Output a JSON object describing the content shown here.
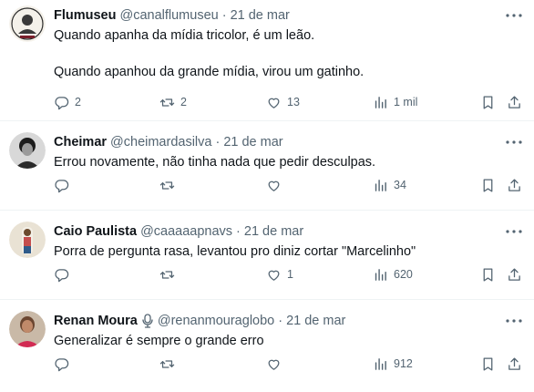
{
  "tweets": [
    {
      "name": "Flumuseu",
      "handle": "@canalflumuseu",
      "date": "21 de mar",
      "text": "Quando apanha da mídia tricolor, é um leão.\n\nQuando apanhou da grande mídia, virou um gatinho.",
      "replies": "2",
      "retweets": "2",
      "likes": "13",
      "views": "1 mil"
    },
    {
      "name": "Cheimar",
      "handle": "@cheimardasilva",
      "date": "21 de mar",
      "text": "Errou novamente, não tinha nada que pedir desculpas.",
      "replies": "",
      "retweets": "",
      "likes": "",
      "views": "34"
    },
    {
      "name": "Caio Paulista",
      "handle": "@caaaaapnavs",
      "date": "21 de mar",
      "text": "Porra de pergunta rasa, levantou pro diniz cortar \"Marcelinho\"",
      "replies": "",
      "retweets": "",
      "likes": "1",
      "views": "620"
    },
    {
      "name": "Renan Moura",
      "handle": "@renanmouraglobo",
      "date": "21 de mar",
      "text": "Generalizar é sempre o grande erro",
      "replies": "",
      "retweets": "",
      "likes": "",
      "views": "912"
    }
  ],
  "icons": {
    "reply": "reply-icon",
    "retweet": "retweet-icon",
    "like": "heart-icon",
    "views": "views-icon",
    "bookmark": "bookmark-icon",
    "share": "share-icon",
    "more": "more-icon",
    "mic": "microphone-icon"
  },
  "colors": {
    "text": "#0f1419",
    "muted": "#536471",
    "border": "#eff3f4"
  }
}
